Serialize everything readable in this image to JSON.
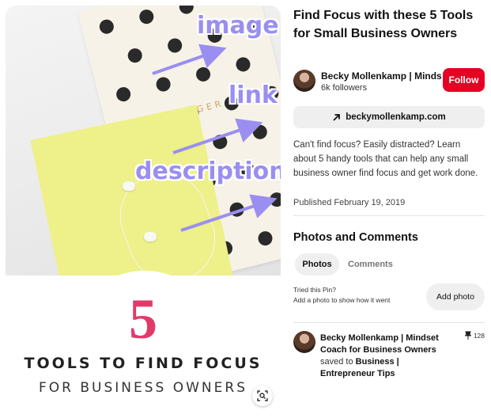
{
  "pin_image": {
    "overlay_labels": [
      "image",
      "link",
      "description"
    ],
    "notebook_text": "GOAL DIGGER",
    "big_number": "5",
    "headline": "TOOLS TO FIND FOCUS",
    "subheadline": "FOR BUSINESS OWNERS",
    "lens_icon": "visual-search-icon",
    "accent_color": "#e13a6a",
    "annotation_color": "#9a8ff0"
  },
  "pin": {
    "title": "Find Focus with these 5 Tools for Small Business Owners",
    "creator": {
      "name": "Becky Mollenkamp | Minds…",
      "followers": "6k followers",
      "follow_label": "Follow",
      "follow_color": "#e60023"
    },
    "link": {
      "icon": "arrow-up-right-icon",
      "text": "beckymollenkamp.com"
    },
    "description": "Can't find focus? Easily distracted? Learn about 5 handy tools that can help any small business owner find focus and get work done.",
    "published": "Published February 19, 2019"
  },
  "photos_comments": {
    "heading": "Photos and Comments",
    "tabs": [
      "Photos",
      "Comments"
    ],
    "active_tab": "Photos",
    "tried_title": "Tried this Pin?",
    "tried_sub": "Add a photo to show how it went",
    "add_photo_label": "Add photo"
  },
  "activity": {
    "name": "Becky Mollenkamp | Mindset Coach for Business Owners",
    "saved_prefix": "saved to",
    "board": "Business | Entrepreneur Tips",
    "pin_count": "128",
    "pin_icon": "pushpin-icon"
  }
}
